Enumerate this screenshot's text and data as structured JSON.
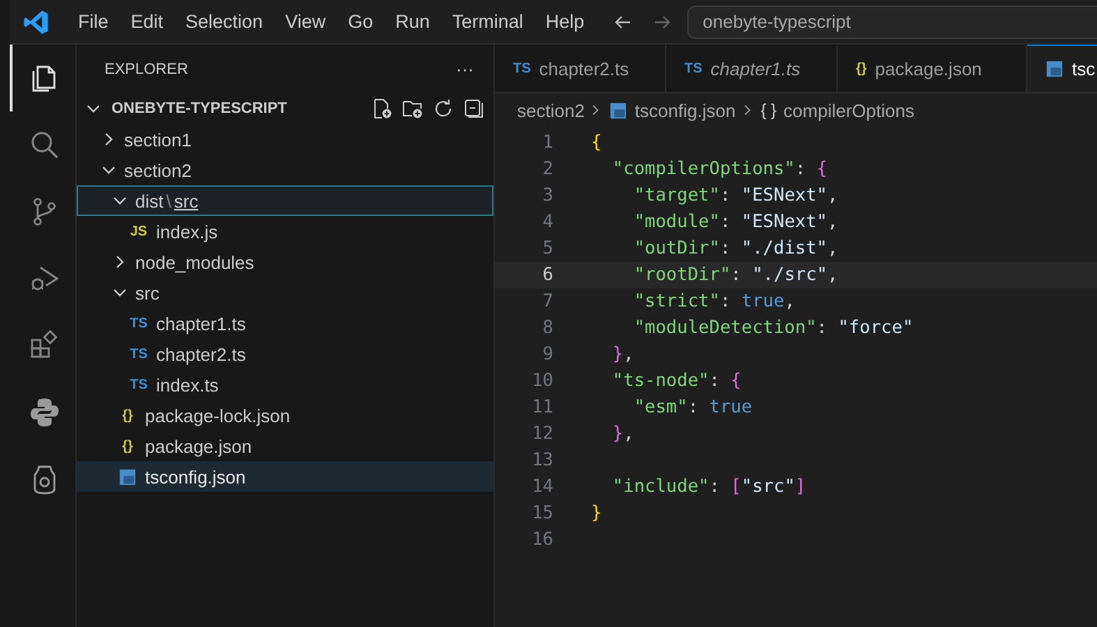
{
  "menu": [
    "File",
    "Edit",
    "Selection",
    "View",
    "Go",
    "Run",
    "Terminal",
    "Help"
  ],
  "command_center": {
    "value": "onebyte-typescript"
  },
  "activity_bar": [
    {
      "kind": "files",
      "selected": true
    },
    {
      "kind": "search",
      "selected": false
    },
    {
      "kind": "scm",
      "selected": false
    },
    {
      "kind": "debug",
      "selected": false
    },
    {
      "kind": "extensions",
      "selected": false
    },
    {
      "kind": "python",
      "selected": false
    },
    {
      "kind": "shield",
      "selected": false
    }
  ],
  "sidebar": {
    "title": "EXPLORER",
    "more": "···",
    "root": {
      "label": "ONEBYTE-TYPESCRIPT",
      "expanded": true
    },
    "items": [
      {
        "kind": "folder",
        "label": "section1",
        "expanded": false,
        "selected": false,
        "focused": false
      },
      {
        "kind": "folder",
        "label": "section2",
        "expanded": true,
        "selected": false,
        "focused": false,
        "children": [
          {
            "kind": "folder",
            "path": [
              "dist",
              "src"
            ],
            "separator": "\\",
            "expanded": true,
            "selected": false,
            "focused": true,
            "children": [
              {
                "kind": "js",
                "badge": "JS",
                "label": "index.js",
                "selected": false,
                "focused": false
              }
            ]
          },
          {
            "kind": "folder",
            "label": "node_modules",
            "expanded": false,
            "selected": false,
            "focused": false
          },
          {
            "kind": "folder",
            "label": "src",
            "expanded": true,
            "selected": false,
            "focused": false,
            "children": [
              {
                "kind": "ts",
                "badge": "TS",
                "label": "chapter1.ts",
                "selected": false,
                "focused": false
              },
              {
                "kind": "ts",
                "badge": "TS",
                "label": "chapter2.ts",
                "selected": false,
                "focused": false
              },
              {
                "kind": "ts",
                "badge": "TS",
                "label": "index.ts",
                "selected": false,
                "focused": false
              }
            ]
          },
          {
            "kind": "json",
            "badge": "{}",
            "label": "package-lock.json",
            "selected": false,
            "focused": false
          },
          {
            "kind": "json",
            "badge": "{}",
            "label": "package.json",
            "selected": false,
            "focused": false
          },
          {
            "kind": "tsconfig",
            "label": "tsconfig.json",
            "selected": true,
            "focused": false
          }
        ]
      }
    ]
  },
  "tabs": [
    {
      "kind": "ts",
      "badge": "TS",
      "label": "chapter2.ts",
      "preview": false,
      "selected": false
    },
    {
      "kind": "ts",
      "badge": "TS",
      "label": "chapter1.ts",
      "preview": true,
      "selected": false
    },
    {
      "kind": "json",
      "badge": "{}",
      "label": "package.json",
      "preview": false,
      "selected": false
    },
    {
      "kind": "tsconfig",
      "label": "tsc",
      "preview": false,
      "selected": true
    }
  ],
  "breadcrumb": [
    {
      "kind": "text",
      "label": "section2"
    },
    {
      "kind": "file",
      "label": "tsconfig.json"
    },
    {
      "kind": "object",
      "badge": "{ }",
      "label": "compilerOptions"
    }
  ],
  "editor": {
    "lines": [
      {
        "number": "1",
        "current": false,
        "tokens": [
          {
            "kind": "b1",
            "t": "{"
          }
        ]
      },
      {
        "number": "2",
        "current": false,
        "tokens": [
          {
            "kind": "key",
            "t": "  \"compilerOptions\""
          },
          {
            "kind": "p",
            "t": ": "
          },
          {
            "kind": "b2",
            "t": "{"
          }
        ]
      },
      {
        "number": "3",
        "current": false,
        "tokens": [
          {
            "kind": "key",
            "t": "    \"target\""
          },
          {
            "kind": "p",
            "t": ": "
          },
          {
            "kind": "str",
            "t": "\"ESNext\""
          },
          {
            "kind": "p",
            "t": ","
          }
        ]
      },
      {
        "number": "4",
        "current": false,
        "tokens": [
          {
            "kind": "key",
            "t": "    \"module\""
          },
          {
            "kind": "p",
            "t": ": "
          },
          {
            "kind": "str",
            "t": "\"ESNext\""
          },
          {
            "kind": "p",
            "t": ","
          }
        ]
      },
      {
        "number": "5",
        "current": false,
        "tokens": [
          {
            "kind": "key",
            "t": "    \"outDir\""
          },
          {
            "kind": "p",
            "t": ": "
          },
          {
            "kind": "str",
            "t": "\"./dist\""
          },
          {
            "kind": "p",
            "t": ","
          }
        ]
      },
      {
        "number": "6",
        "current": true,
        "tokens": [
          {
            "kind": "key",
            "t": "    \"rootDir\""
          },
          {
            "kind": "p",
            "t": ": "
          },
          {
            "kind": "str",
            "t": "\"./src\""
          },
          {
            "kind": "p",
            "t": ","
          }
        ]
      },
      {
        "number": "7",
        "current": false,
        "tokens": [
          {
            "kind": "key",
            "t": "    \"strict\""
          },
          {
            "kind": "p",
            "t": ": "
          },
          {
            "kind": "bool",
            "t": "true"
          },
          {
            "kind": "p",
            "t": ","
          }
        ]
      },
      {
        "number": "8",
        "current": false,
        "tokens": [
          {
            "kind": "key",
            "t": "    \"moduleDetection\""
          },
          {
            "kind": "p",
            "t": ": "
          },
          {
            "kind": "str",
            "t": "\"force\""
          }
        ]
      },
      {
        "number": "9",
        "current": false,
        "tokens": [
          {
            "kind": "b2",
            "t": "  }"
          },
          {
            "kind": "p",
            "t": ","
          }
        ]
      },
      {
        "number": "10",
        "current": false,
        "tokens": [
          {
            "kind": "key",
            "t": "  \"ts-node\""
          },
          {
            "kind": "p",
            "t": ": "
          },
          {
            "kind": "b2",
            "t": "{"
          }
        ]
      },
      {
        "number": "11",
        "current": false,
        "tokens": [
          {
            "kind": "key",
            "t": "    \"esm\""
          },
          {
            "kind": "p",
            "t": ": "
          },
          {
            "kind": "bool",
            "t": "true"
          }
        ]
      },
      {
        "number": "12",
        "current": false,
        "tokens": [
          {
            "kind": "b2",
            "t": "  }"
          },
          {
            "kind": "p",
            "t": ","
          }
        ]
      },
      {
        "number": "13",
        "current": false
      },
      {
        "number": "14",
        "current": false,
        "tokens": [
          {
            "kind": "key",
            "t": "  \"include\""
          },
          {
            "kind": "p",
            "t": ": "
          },
          {
            "kind": "b2",
            "t": "["
          },
          {
            "kind": "str",
            "t": "\"src\""
          },
          {
            "kind": "b2",
            "t": "]"
          }
        ]
      },
      {
        "number": "15",
        "current": false,
        "tokens": [
          {
            "kind": "b1",
            "t": "}"
          }
        ]
      },
      {
        "number": "16",
        "current": false
      }
    ]
  }
}
